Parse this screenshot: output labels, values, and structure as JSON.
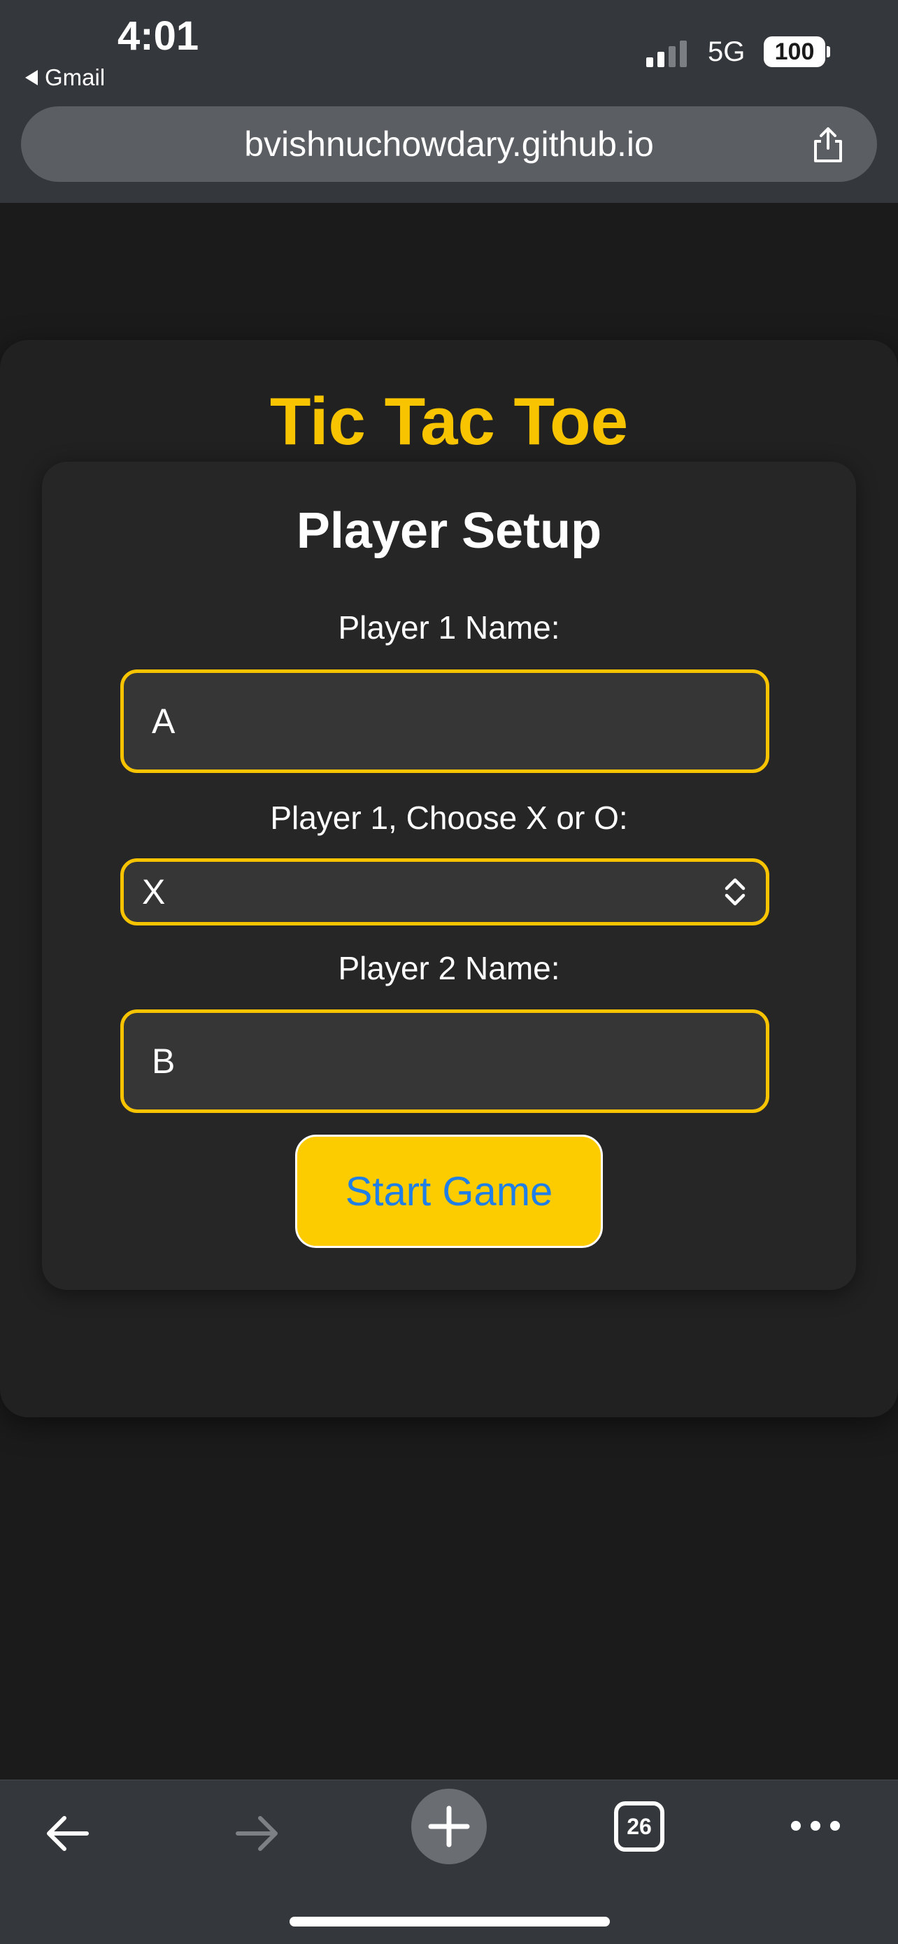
{
  "status_bar": {
    "time": "4:01",
    "back_app": "Gmail",
    "network": "5G",
    "battery": "100"
  },
  "browser": {
    "url": "bvishnuchowdary.github.io",
    "tab_count": "26"
  },
  "page": {
    "title": "Tic Tac Toe",
    "setup_title": "Player Setup",
    "player1_label": "Player 1 Name:",
    "player1_value": "A",
    "symbol_label": "Player 1, Choose X or O:",
    "symbol_value": "X",
    "player2_label": "Player 2 Name:",
    "player2_value": "B",
    "start_button": "Start Game"
  },
  "colors": {
    "accent": "#f8c400",
    "button_text": "#1f7fe6",
    "background": "#1b1b1b"
  },
  "icons": [
    "share-icon",
    "back-arrow-icon",
    "forward-arrow-icon",
    "plus-icon",
    "tabs-icon",
    "more-icon",
    "chevron-updown-icon"
  ]
}
